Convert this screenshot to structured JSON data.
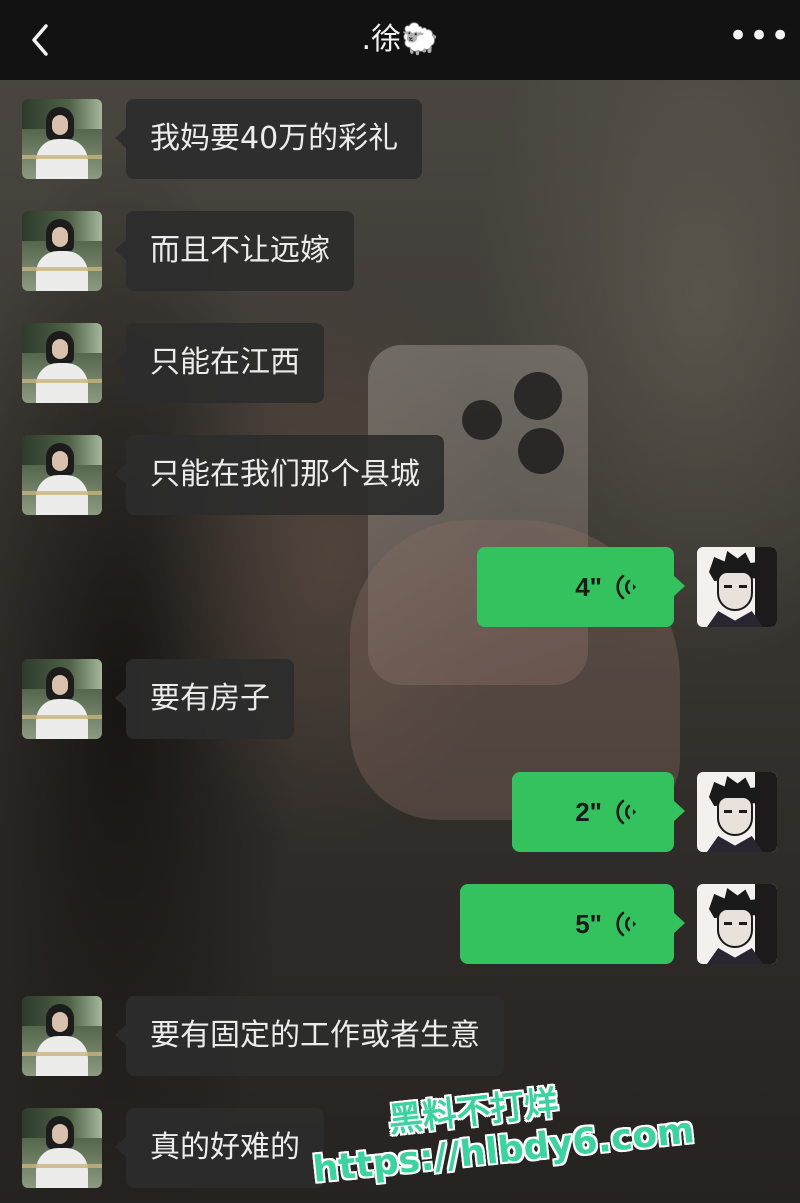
{
  "header": {
    "title": ".徐🐑",
    "back_icon": "chevron-left-icon",
    "more_label": "•••"
  },
  "messages": [
    {
      "direction": "in",
      "text": "我妈要40万的彩礼"
    },
    {
      "direction": "in",
      "text": "而且不让远嫁"
    },
    {
      "direction": "in",
      "text": "只能在江西"
    },
    {
      "direction": "in",
      "text": "只能在我们那个县城"
    },
    {
      "direction": "out",
      "type": "voice",
      "duration": "4\""
    },
    {
      "direction": "in",
      "text": "要有房子"
    },
    {
      "direction": "out",
      "type": "voice",
      "duration": "2\""
    },
    {
      "direction": "out",
      "type": "voice",
      "duration": "5\""
    },
    {
      "direction": "in",
      "text": "要有固定的工作或者生意"
    },
    {
      "direction": "in",
      "text": "真的好难的"
    }
  ],
  "watermark": {
    "line1": "黑料不打烊",
    "line2": "https://hlbdy6.com"
  },
  "colors": {
    "header_bg": "#121212",
    "incoming_bubble": "#2c2c2c",
    "outgoing_bubble": "#34c25e",
    "watermark": "#3cd3a0"
  }
}
